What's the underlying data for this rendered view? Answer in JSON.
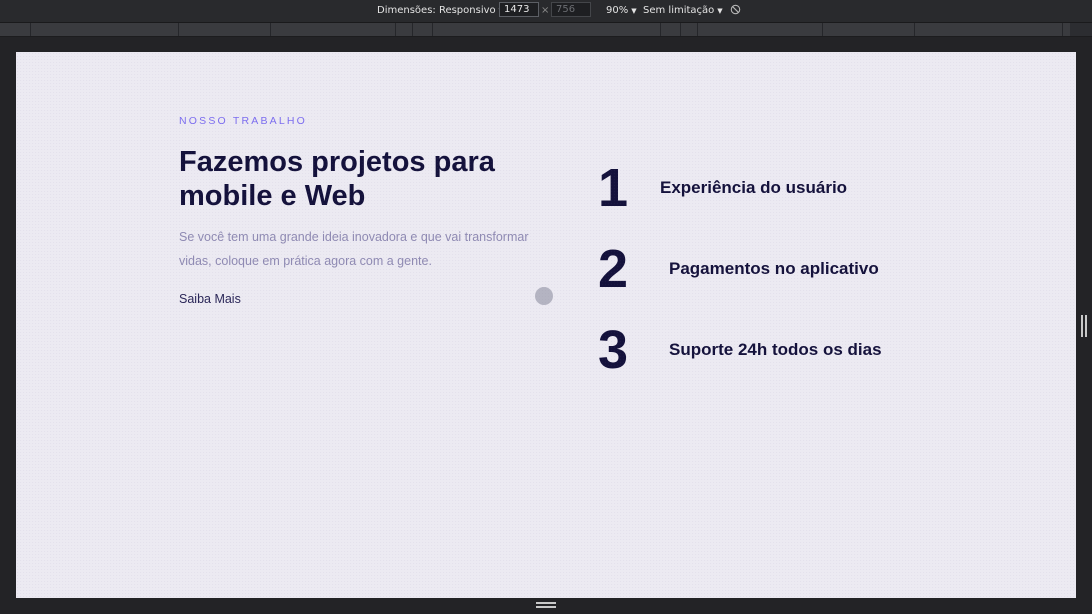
{
  "devtools": {
    "dimensions_label": "Dimensões: Responsivo",
    "width_value": "1473",
    "height_value": "756",
    "separator": "×",
    "zoom": "90%",
    "throttle": "Sem limitação"
  },
  "section": {
    "eyebrow": "NOSSO TRABALHO",
    "headline": "Fazemos projetos para mobile e Web",
    "description": "Se você tem uma grande ideia inovadora e que vai transformar vidas, coloque em prática agora com a gente.",
    "link_label": "Saiba Mais"
  },
  "features": [
    {
      "number": "1",
      "label": "Experiência do usuário"
    },
    {
      "number": "2",
      "label": "Pagamentos no aplicativo"
    },
    {
      "number": "3",
      "label": "Suporte 24h todos os dias"
    }
  ],
  "colors": {
    "accent": "#7c6df0",
    "text_dark": "#14113b",
    "text_muted": "#8f8ab3",
    "page_bg": "#eceaf2",
    "devtools_bg": "#292a2d"
  }
}
